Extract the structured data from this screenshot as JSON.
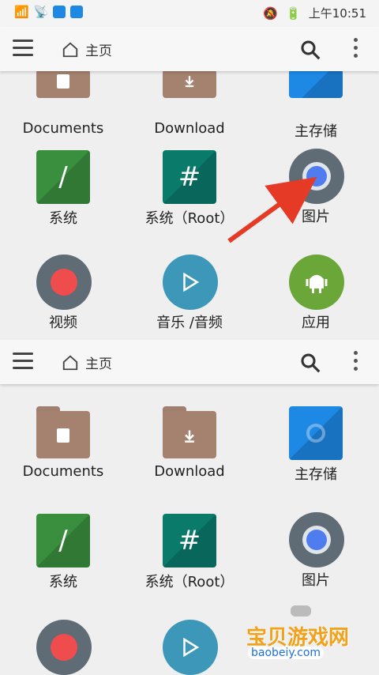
{
  "status": {
    "left": "⁴ᴳ",
    "time": "上午10:51"
  },
  "header": {
    "home_label": "主页"
  },
  "grid": {
    "row1": [
      "Documents",
      "Download",
      "主存储"
    ],
    "row2": [
      "系统",
      "系统（Root）",
      "图片"
    ],
    "row3": [
      "视频",
      "音乐 /音频",
      "应用"
    ]
  },
  "icons": {
    "system_char": "/",
    "root_char": "#",
    "play": "▶"
  },
  "colors": {
    "arrow": "#e53b26",
    "green": "#3a8f3f",
    "teal": "#0a7b6b",
    "blue": "#1e88e5",
    "folder": "#a4826f"
  },
  "watermark": {
    "title": "宝贝游戏网",
    "url": "baobeiy.com"
  }
}
